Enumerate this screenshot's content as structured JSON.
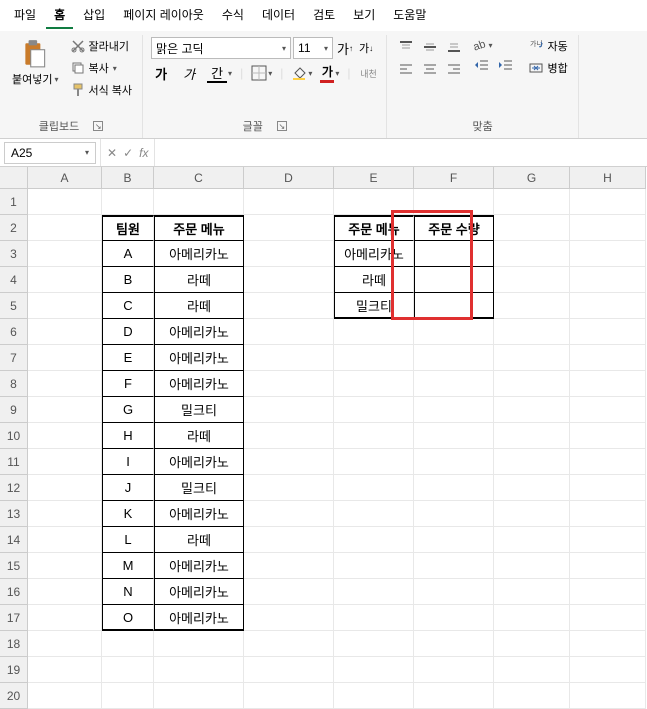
{
  "menu": [
    "파일",
    "홈",
    "삽입",
    "페이지 레이아웃",
    "수식",
    "데이터",
    "검토",
    "보기",
    "도움말"
  ],
  "menu_active": 1,
  "ribbon": {
    "clipboard": {
      "paste": "붙여넣기",
      "cut": "잘라내기",
      "copy": "복사",
      "format_painter": "서식 복사",
      "label": "클립보드"
    },
    "font": {
      "name": "맑은 고딕",
      "size": "11",
      "increase": "가",
      "decrease": "가",
      "bold": "가",
      "italic": "가",
      "underline": "간",
      "wrap": "내천",
      "label": "글꼴"
    },
    "align": {
      "auto": "자동",
      "merge": "병합",
      "label": "맞춤"
    }
  },
  "namebox": "A25",
  "formula": "",
  "cols": [
    "A",
    "B",
    "C",
    "D",
    "E",
    "F",
    "G",
    "H"
  ],
  "rows_n": 20,
  "table1": {
    "headers": [
      "팀원",
      "주문 메뉴"
    ],
    "rows": [
      [
        "A",
        "아메리카노"
      ],
      [
        "B",
        "라떼"
      ],
      [
        "C",
        "라떼"
      ],
      [
        "D",
        "아메리카노"
      ],
      [
        "E",
        "아메리카노"
      ],
      [
        "F",
        "아메리카노"
      ],
      [
        "G",
        "밀크티"
      ],
      [
        "H",
        "라떼"
      ],
      [
        "I",
        "아메리카노"
      ],
      [
        "J",
        "밀크티"
      ],
      [
        "K",
        "아메리카노"
      ],
      [
        "L",
        "라떼"
      ],
      [
        "M",
        "아메리카노"
      ],
      [
        "N",
        "아메리카노"
      ],
      [
        "O",
        "아메리카노"
      ]
    ]
  },
  "table2": {
    "headers": [
      "주문 메뉴",
      "주문 수량"
    ],
    "rows": [
      [
        "아메리카노",
        ""
      ],
      [
        "라떼",
        ""
      ],
      [
        "밀크티",
        ""
      ]
    ]
  }
}
